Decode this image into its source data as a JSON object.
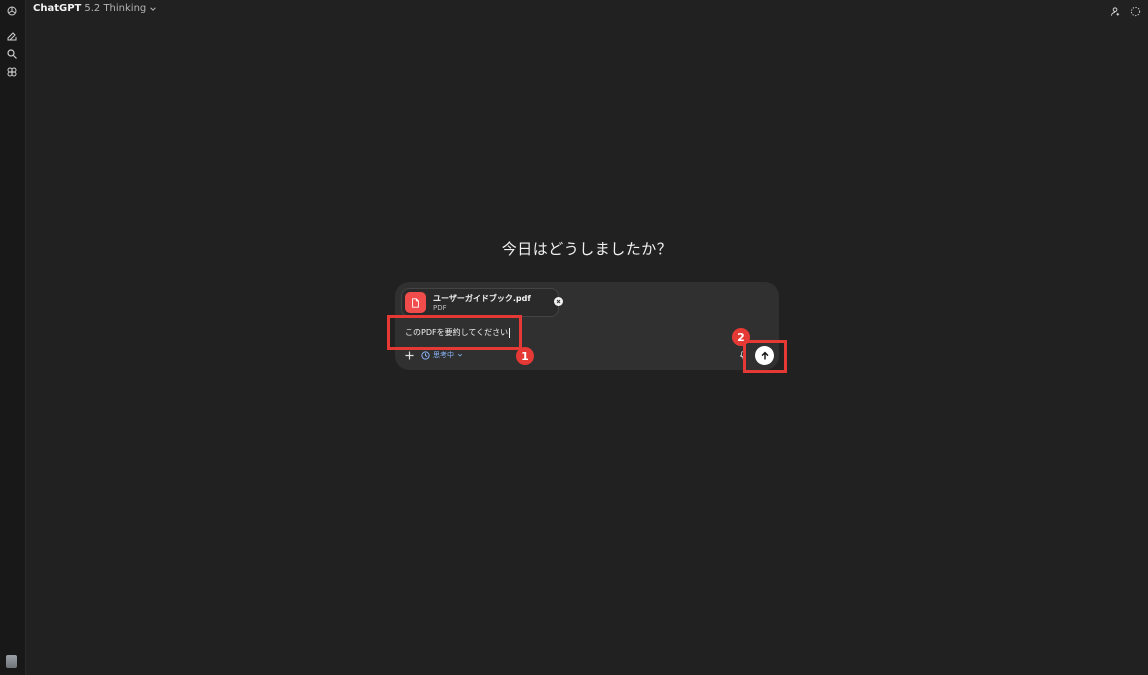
{
  "header": {
    "model_name": "ChatGPT",
    "model_version": "5.2 Thinking",
    "icons": [
      "profile-icon",
      "temporary-chat-icon"
    ]
  },
  "sidebar": {
    "icons": [
      "openai-logo-icon",
      "new-chat-icon",
      "search-icon",
      "gpts-icon"
    ]
  },
  "main": {
    "greeting": "今日はどうしましたか？"
  },
  "composer": {
    "attachment": {
      "file_name": "ユーザーガイドブック.pdf",
      "file_type": "PDF"
    },
    "prompt_text": "このPDFを要約してください",
    "thinking_label": "思考中"
  },
  "annotations": {
    "step1": "1",
    "step2": "2",
    "highlight_color": "#e53935"
  },
  "colors": {
    "background": "#212121",
    "composer": "#303030",
    "pdf_tile": "#f14c4c",
    "thinking_accent": "#8ab4f8"
  }
}
